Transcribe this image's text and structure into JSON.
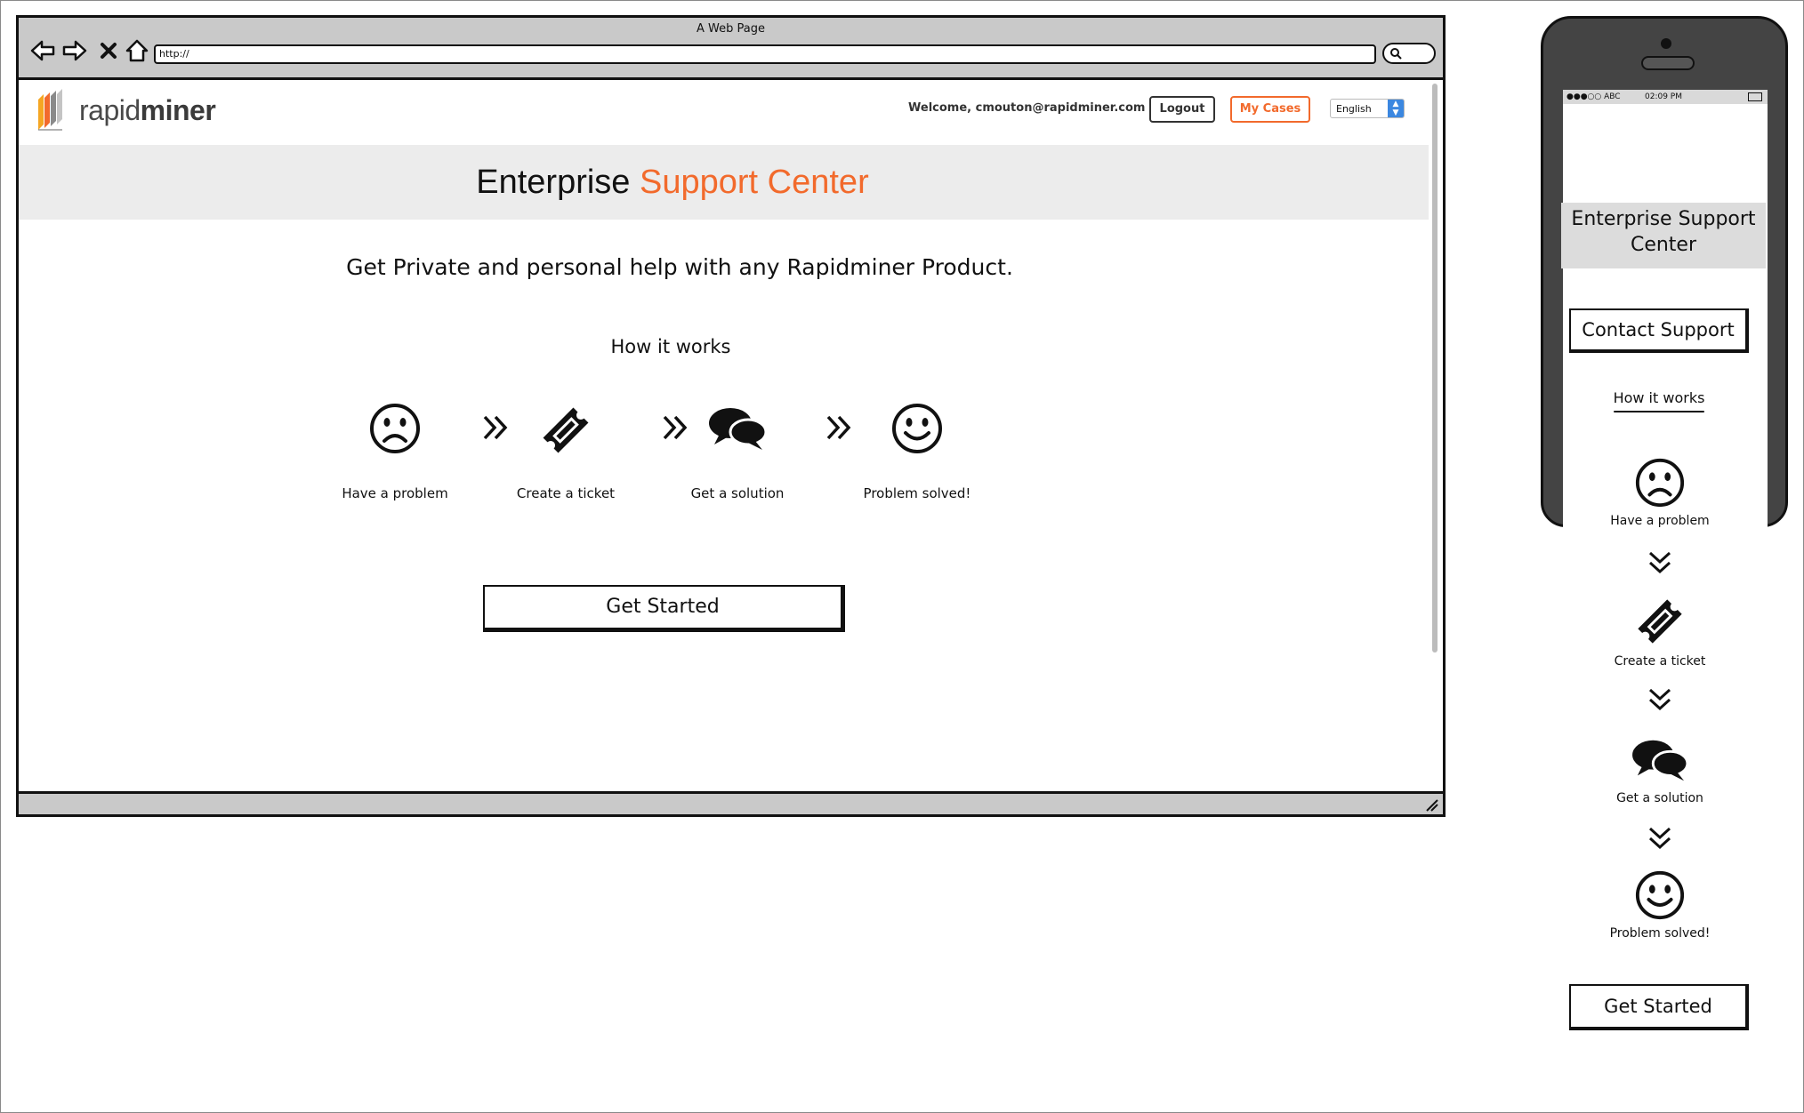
{
  "browser": {
    "window_title": "A Web Page",
    "url": "http://",
    "nav_icons": [
      "back-arrow-icon",
      "forward-arrow-icon",
      "close-x-icon",
      "home-icon"
    ]
  },
  "header": {
    "logo_text_light": "rapid",
    "logo_text_bold": "miner",
    "welcome": "Welcome, cmouton@rapidminer.com",
    "logout_label": "Logout",
    "my_cases_label": "My Cases",
    "language": "English"
  },
  "hero": {
    "title_main": "Enterprise",
    "title_accent": "Support Center"
  },
  "main": {
    "subtitle": "Get Private and personal help with any Rapidminer Product.",
    "how_it_works": "How it works",
    "steps": [
      {
        "label": "Have a problem",
        "icon": "sad-face-icon"
      },
      {
        "label": "Create a ticket",
        "icon": "ticket-icon"
      },
      {
        "label": "Get a solution",
        "icon": "chat-bubbles-icon"
      },
      {
        "label": "Problem solved!",
        "icon": "smiley-face-icon"
      }
    ],
    "get_started_label": "Get Started"
  },
  "mobile": {
    "carrier": "●●●○○ ABC",
    "time": "02:09 PM",
    "hero_title": "Enterprise Support Center",
    "contact_label": "Contact Support",
    "how_it_works": "How it works",
    "steps": [
      {
        "label": "Have a problem",
        "icon": "sad-face-icon"
      },
      {
        "label": "Create a ticket",
        "icon": "ticket-icon"
      },
      {
        "label": "Get a solution",
        "icon": "chat-bubbles-icon"
      },
      {
        "label": "Problem solved!",
        "icon": "smiley-face-icon"
      }
    ],
    "get_started_label": "Get Started"
  },
  "colors": {
    "accent": "#f26a2c",
    "hero_bg": "#ececec",
    "chrome": "#c9c9c9",
    "phone_body": "#444444",
    "select_blue": "#3b87e0"
  }
}
